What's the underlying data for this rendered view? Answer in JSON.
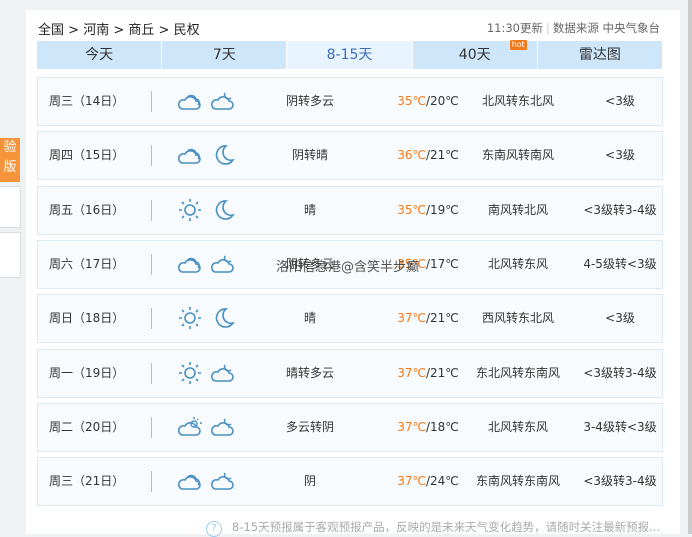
{
  "breadcrumb": [
    "全国",
    "河南",
    "商丘",
    "民权"
  ],
  "update": "11:30更新",
  "source": "数据来源 中央气象台",
  "tabs": [
    {
      "label": "今天"
    },
    {
      "label": "7天"
    },
    {
      "label": "8-15天",
      "active": true
    },
    {
      "label": "40天",
      "badge": "hot"
    },
    {
      "label": "雷达图"
    }
  ],
  "rows": [
    {
      "day": "周三（14日）",
      "icons": [
        "cloudy",
        "cloudy-night"
      ],
      "weather": "阴转多云",
      "high": "35℃",
      "low": "/20℃",
      "wind": "北风转东北风",
      "level": "<3级"
    },
    {
      "day": "周四（15日）",
      "icons": [
        "cloudy",
        "moon"
      ],
      "weather": "阴转晴",
      "high": "36℃",
      "low": "/21℃",
      "wind": "东南风转南风",
      "level": "<3级"
    },
    {
      "day": "周五（16日）",
      "icons": [
        "sun",
        "moon"
      ],
      "weather": "晴",
      "high": "35℃",
      "low": "/19℃",
      "wind": "南风转北风",
      "level": "<3级转3-4级"
    },
    {
      "day": "周六（17日）",
      "icons": [
        "cloudy",
        "cloudy-night"
      ],
      "weather": "阴转多云",
      "high": "35℃",
      "low": "/17℃",
      "wind": "北风转东风",
      "level": "4-5级转<3级"
    },
    {
      "day": "周日（18日）",
      "icons": [
        "sun",
        "moon"
      ],
      "weather": "晴",
      "high": "37℃",
      "low": "/21℃",
      "wind": "西风转东北风",
      "level": "<3级"
    },
    {
      "day": "周一（19日）",
      "icons": [
        "sun",
        "cloudy-night"
      ],
      "weather": "晴转多云",
      "high": "37℃",
      "low": "/21℃",
      "wind": "东北风转东南风",
      "level": "<3级转3-4级"
    },
    {
      "day": "周二（20日）",
      "icons": [
        "partly-cloudy",
        "cloudy-night"
      ],
      "weather": "多云转阴",
      "high": "37℃",
      "low": "/18℃",
      "wind": "北风转东风",
      "level": "3-4级转<3级"
    },
    {
      "day": "周三（21日）",
      "icons": [
        "cloudy",
        "cloudy-night"
      ],
      "weather": "阴",
      "high": "37℃",
      "low": "/24℃",
      "wind": "东南风转东南风",
      "level": "<3级转3-4级"
    }
  ],
  "watermark": "洛阳信息港@含笑半步癫",
  "footer": "8-15天预报属于客观预报产品，反映的是未来天气变化趋势，请随时关注最新预报...",
  "side": {
    "label": "验版"
  },
  "colors": {
    "accent": "#f27a1a",
    "tab": "#cde6f9",
    "icon": "#4a90c0"
  }
}
